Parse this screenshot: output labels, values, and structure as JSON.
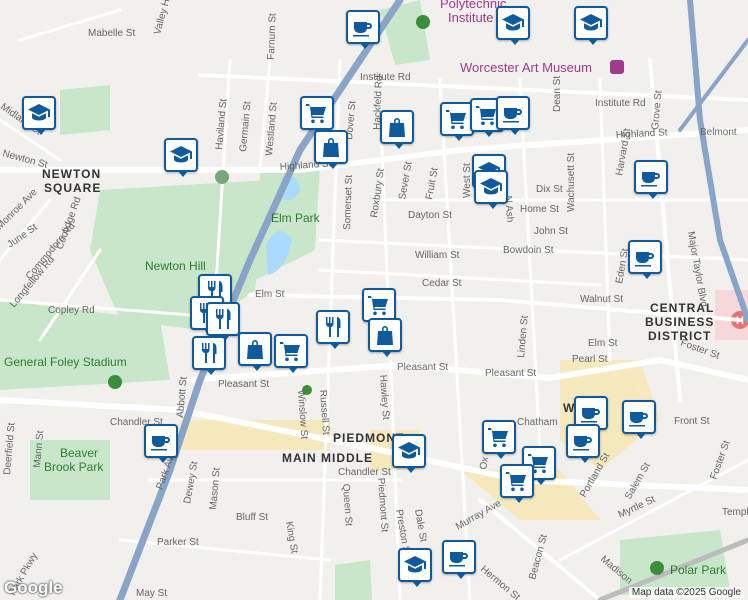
{
  "map": {
    "attribution": "Map data ©2025 Google",
    "logo": "Google",
    "districts": [
      {
        "id": "newton-square-1",
        "text": "NEWTON"
      },
      {
        "id": "newton-square-2",
        "text": "SQUARE"
      },
      {
        "id": "cbd-1",
        "text": "CENTRAL"
      },
      {
        "id": "cbd-2",
        "text": "BUSINESS"
      },
      {
        "id": "cbd-3",
        "text": "DISTRICT"
      },
      {
        "id": "piedmont",
        "text": "PIEDMONT"
      },
      {
        "id": "main-middle",
        "text": "MAIN MIDDLE"
      }
    ],
    "parks": [
      {
        "id": "elm-park",
        "text": "Elm Park"
      },
      {
        "id": "newton-hill",
        "text": "Newton Hill"
      },
      {
        "id": "foley",
        "text": "General Foley Stadium"
      },
      {
        "id": "beaver-1",
        "text": "Beaver"
      },
      {
        "id": "beaver-2",
        "text": "Brook Park"
      },
      {
        "id": "polar",
        "text": "Polar Park"
      }
    ],
    "pois": [
      {
        "id": "polytechnic-1",
        "text": "Polytechnic"
      },
      {
        "id": "polytechnic-2",
        "text": "Institute"
      },
      {
        "id": "art-museum",
        "text": "Worcester Art Museum"
      }
    ],
    "streets": {
      "highland_w": "Highland St",
      "highland_e": "Highland St",
      "belmont": "Belmont",
      "institute_w": "Institute Rd",
      "institute_e": "Institute Rd",
      "pleasant_w": "Pleasant St",
      "pleasant_m": "Pleasant St",
      "pleasant_e": "Pleasant St",
      "elm_w": "Elm St",
      "elm_e": "Elm St",
      "chandler_w": "Chandler St",
      "chandler_e": "Chandler St",
      "william": "William St",
      "cedar": "Cedar St",
      "walnut": "Walnut St",
      "dayton": "Dayton St",
      "john": "John St",
      "bowdoin": "Bowdoin St",
      "home": "Home St",
      "dix": "Dix St",
      "pearl": "Pearl St",
      "foster_1": "Foster St",
      "foster_2": "Foster St",
      "front": "Front St",
      "mabelle": "Mabelle St",
      "grove": "Grove St",
      "major_taylor": "Major Taylor Blvd",
      "harvard": "Harvard St",
      "wachusett": "Wachusett St",
      "dean": "Dean St",
      "west": "West St",
      "n_ash": "N Ash",
      "sever": "Sever St",
      "fruit": "Fruit St",
      "roxbury": "Roxbury St",
      "somerset": "Somerset St",
      "hackfeld": "Hackfeld Rd",
      "dover": "Dover St",
      "haviland": "Haviland St",
      "germain": "Germain St",
      "westland": "Westland St",
      "farnum": "Farnum St",
      "june": "June St",
      "coolidge": "Coolidge Rd",
      "commodore": "Commodore Rd",
      "longfellow": "Longfellow Rd",
      "copley": "Copley Rd",
      "monroe": "Monroe Ave",
      "midland": "Midland St",
      "newton_st": "Newton St",
      "linden": "Linden St",
      "eden": "Eden St",
      "hawley": "Hawley St",
      "russell": "Russell St",
      "winslow": "Winslow St",
      "queen": "Queen St",
      "piedmont_st": "Piedmont St",
      "preston": "Preston St",
      "dale": "Dale St",
      "murray": "Murray Ave",
      "beacon": "Beacon St",
      "hermon": "Hermon St",
      "madison": "Madison",
      "myrtle": "Myrtle St",
      "portland": "Portland St",
      "salem": "Salem St",
      "temple": "Temple",
      "may": "May St",
      "parker": "Parker St",
      "bluff": "Bluff St",
      "king": "King St",
      "mason": "Mason St",
      "dewey": "Dewey St",
      "abbott": "Abbott St",
      "park_ave": "Park Ave",
      "deerfield": "Deerfield St",
      "mann": "Mann St",
      "park_pkwy": "Park Pkwy",
      "valley": "Valley Hill",
      "oxford": "Ox",
      "chatham": "Chatham",
      "w_label": "W"
    }
  },
  "markers": [
    {
      "type": "cafe",
      "name": "cafe-icon"
    },
    {
      "type": "school",
      "name": "school-icon"
    },
    {
      "type": "school",
      "name": "school-icon"
    },
    {
      "type": "school",
      "name": "school-icon"
    },
    {
      "type": "shopping-cart",
      "name": "shopping-cart-icon"
    },
    {
      "type": "shopping-bag",
      "name": "shopping-bag-icon"
    },
    {
      "type": "shopping-bag",
      "name": "shopping-bag-icon"
    },
    {
      "type": "school",
      "name": "school-icon"
    },
    {
      "type": "shopping-cart",
      "name": "shopping-cart-icon"
    },
    {
      "type": "shopping-cart",
      "name": "shopping-cart-icon"
    },
    {
      "type": "cafe",
      "name": "cafe-icon"
    },
    {
      "type": "school",
      "name": "school-icon"
    },
    {
      "type": "school",
      "name": "school-icon"
    },
    {
      "type": "cafe",
      "name": "cafe-icon"
    },
    {
      "type": "cafe",
      "name": "cafe-icon"
    },
    {
      "type": "restaurant",
      "name": "restaurant-icon"
    },
    {
      "type": "restaurant",
      "name": "restaurant-icon"
    },
    {
      "type": "restaurant",
      "name": "restaurant-icon"
    },
    {
      "type": "shopping-bag",
      "name": "shopping-bag-icon"
    },
    {
      "type": "shopping-cart",
      "name": "shopping-cart-icon"
    },
    {
      "type": "shopping-cart",
      "name": "shopping-cart-icon"
    },
    {
      "type": "restaurant",
      "name": "restaurant-icon"
    },
    {
      "type": "restaurant",
      "name": "restaurant-icon"
    },
    {
      "type": "shopping-bag",
      "name": "shopping-bag-icon"
    },
    {
      "type": "cafe",
      "name": "cafe-icon"
    },
    {
      "type": "school",
      "name": "school-icon"
    },
    {
      "type": "shopping-cart",
      "name": "shopping-cart-icon"
    },
    {
      "type": "shopping-cart",
      "name": "shopping-cart-icon"
    },
    {
      "type": "shopping-cart",
      "name": "shopping-cart-icon"
    },
    {
      "type": "cafe",
      "name": "cafe-icon"
    },
    {
      "type": "cafe",
      "name": "cafe-icon"
    },
    {
      "type": "cafe",
      "name": "cafe-icon"
    },
    {
      "type": "school",
      "name": "school-icon"
    },
    {
      "type": "cafe",
      "name": "cafe-icon"
    }
  ],
  "colors": {
    "marker_border": "#0f5a9c",
    "park_green": "#c8e6c9",
    "highway": "#8aa4c8",
    "road": "#ffffff",
    "transit_yellow": "#f6e6a8",
    "hospital": "#e57373"
  }
}
